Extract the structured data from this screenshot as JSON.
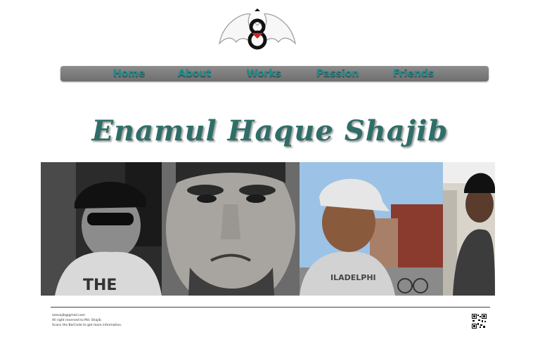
{
  "nav": {
    "items": [
      {
        "label": "Home"
      },
      {
        "label": "About"
      },
      {
        "label": "Works"
      },
      {
        "label": "Passion"
      },
      {
        "label": "Friends"
      }
    ]
  },
  "header": {
    "title": "Enamul Haque Shajib"
  },
  "footer": {
    "email": "iamsajib@gmail.com",
    "rights": "All right reserved to Md. Shajib.",
    "qr_note": "Scans the BarCode to get more information."
  },
  "colors": {
    "nav_text": "#1f8f8f",
    "title": "#2f6e68",
    "nav_bar": "#7a7a7a"
  },
  "icons": {
    "logo": "bat-logo",
    "qr": "qr-code"
  }
}
